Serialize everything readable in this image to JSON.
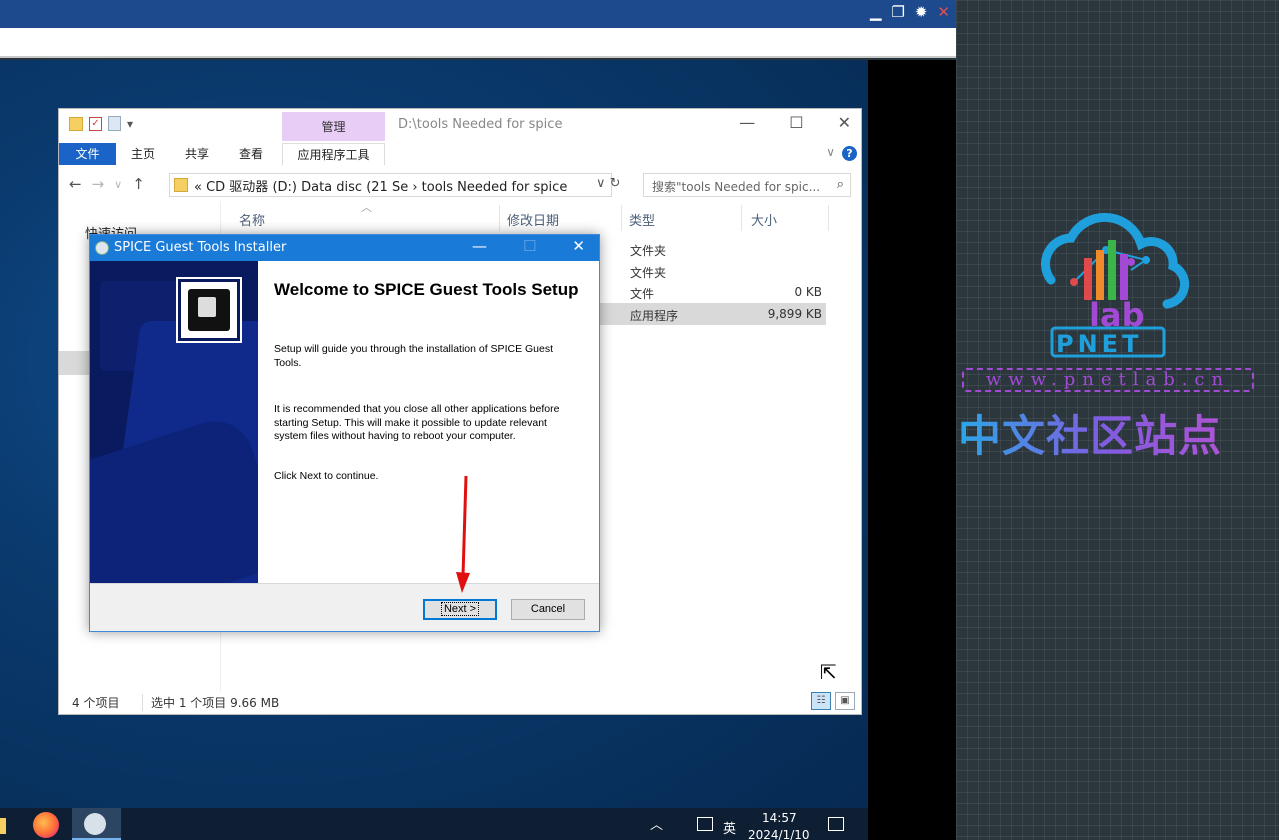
{
  "explorer": {
    "title": "D:\\tools Needed for spice",
    "context_tab": "管理",
    "ribbon_tabs": [
      "文件",
      "主页",
      "共享",
      "查看",
      "应用程序工具"
    ],
    "address": "« CD 驱动器 (D:) Data disc (21 Se  ›  tools Needed for spice",
    "search_placeholder": "搜索\"tools Needed for spic...",
    "quick_access": "快速访问",
    "columns": [
      "名称",
      "修改日期",
      "类型",
      "大小"
    ],
    "files": [
      {
        "type": "文件夹",
        "size": ""
      },
      {
        "type": "文件夹",
        "size": ""
      },
      {
        "type": "文件",
        "size": "0 KB"
      },
      {
        "type": "应用程序",
        "size": "9,899 KB"
      }
    ],
    "status_count": "4 个项目",
    "status_selected": "选中 1 个项目  9.66 MB"
  },
  "installer": {
    "title": "SPICE Guest Tools Installer",
    "heading": "Welcome to SPICE Guest Tools Setup",
    "paragraph1": "Setup will guide you through the installation of SPICE Guest Tools.",
    "paragraph2": "It is recommended that you close all other applications before starting Setup. This will make it possible to update relevant system files without having to reboot your computer.",
    "paragraph3": "Click Next to continue.",
    "next_label": "Next >",
    "cancel_label": "Cancel"
  },
  "taskbar": {
    "ime": "英",
    "time": "14:57",
    "date": "2024/1/10"
  },
  "branding": {
    "url": "www.pnetlab.cn",
    "logo_text": "PNET",
    "logo_lab": "lab",
    "slogan": "中文社区站点"
  },
  "colors": {
    "accent": "#1a7ad8",
    "file_tab": "#1a64c7",
    "manage_tab": "#e8cdf6",
    "arrow": "#e01010",
    "logo_blue": "#1fa0dc",
    "logo_purple": "#a24ad6"
  }
}
